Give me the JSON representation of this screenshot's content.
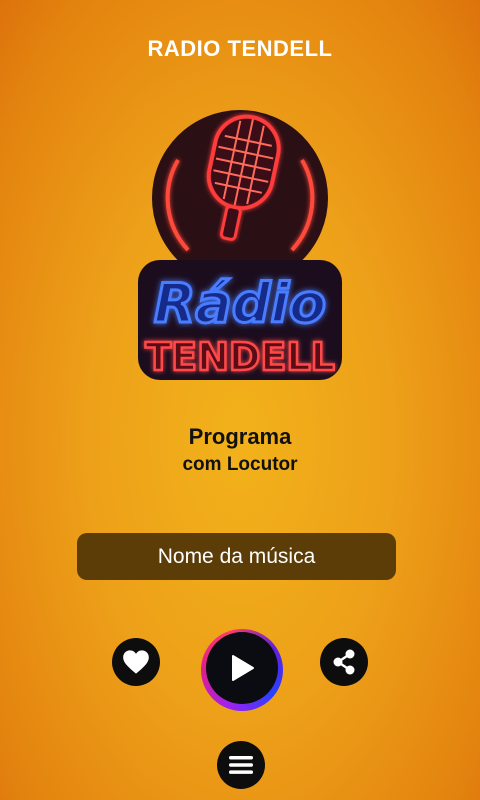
{
  "header": {
    "title": "RADIO TENDELL"
  },
  "logo": {
    "line1": "Rádio",
    "line2": "TENDELL",
    "icon": "microphone-icon"
  },
  "program": {
    "name": "Programa",
    "host": "com Locutor"
  },
  "now_playing": {
    "song": "Nome da música"
  },
  "controls": {
    "like_icon": "heart-icon",
    "play_icon": "play-icon",
    "share_icon": "share-icon",
    "menu_icon": "menu-icon"
  },
  "colors": {
    "background": "#eda019",
    "song_bar": "#5c3d08",
    "neon_red": "#ff3a3a",
    "neon_blue": "#2f5cff",
    "button": "#0d0d0d"
  }
}
